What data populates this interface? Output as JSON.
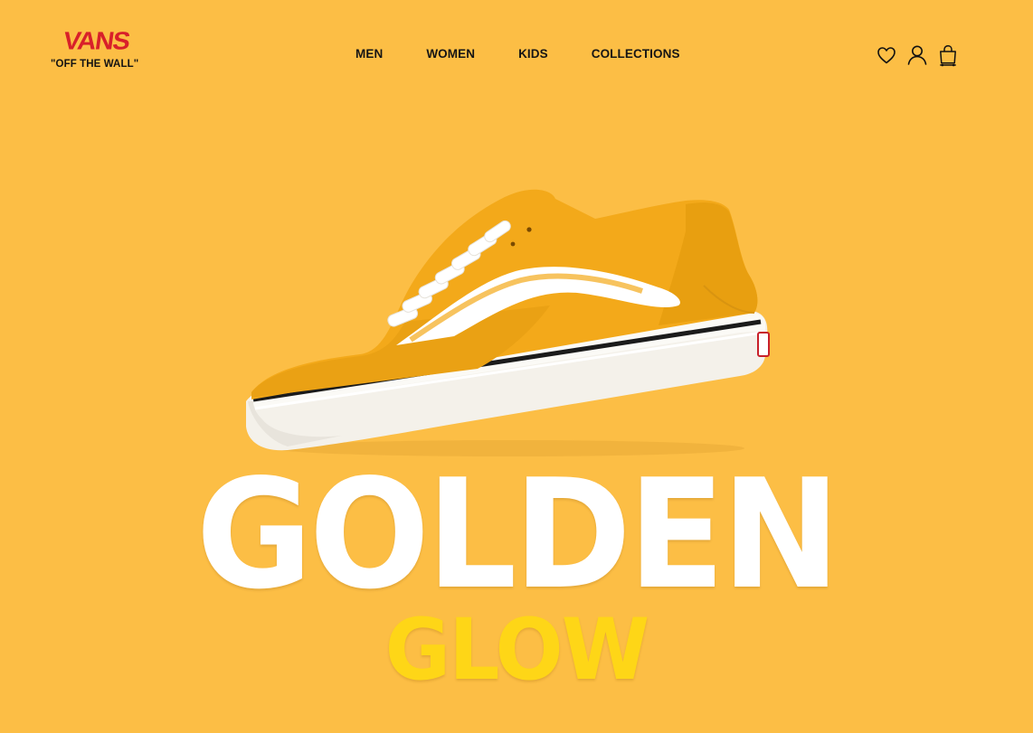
{
  "brand": {
    "name": "VANS",
    "tagline": "\"OFF THE WALL\""
  },
  "nav": {
    "items": [
      {
        "label": "MEN"
      },
      {
        "label": "WOMEN"
      },
      {
        "label": "KIDS"
      },
      {
        "label": "COLLECTIONS"
      }
    ]
  },
  "header_icons": [
    "heart-icon",
    "user-icon",
    "shopping-bag-icon"
  ],
  "hero": {
    "image": "yellow-old-skool-sneaker",
    "title": "GOLDEN",
    "subtitle": "GLOW"
  },
  "colors": {
    "background": "#fcbe45",
    "brand_red": "#d8202a",
    "title": "#ffffff",
    "subtitle": "#fed617",
    "nav_text": "#151515"
  }
}
